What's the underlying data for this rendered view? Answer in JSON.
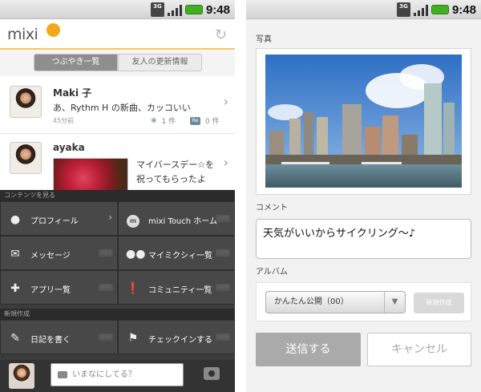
{
  "status_bar": {
    "time": "9:48",
    "network": "3G"
  },
  "left": {
    "app": {
      "logo": "mixi"
    },
    "tabs": [
      {
        "label": "つぶやき一覧",
        "active": true
      },
      {
        "label": "友人の更新情報",
        "active": false
      }
    ],
    "feed": [
      {
        "name": "Maki 子",
        "text": "あ、Rythm H の新曲、カッコいい",
        "time": "45分前",
        "likes": "1 件",
        "comments": "0 件"
      },
      {
        "name": "ayaka",
        "text_line1": "マイバースデー☆を",
        "text_line2": "祝ってもらったよ"
      }
    ],
    "menu": {
      "section_contents": "コンテンツを見る",
      "section_new": "新規作成",
      "web_tag": "WEB",
      "items": [
        {
          "label": "プロフィール",
          "icon": "person-icon"
        },
        {
          "label": "mixi Touch ホーム",
          "icon": "mixi-touch-icon"
        },
        {
          "label": "メッセージ",
          "icon": "envelope-icon"
        },
        {
          "label": "マイミクシィ一覧",
          "icon": "friends-icon"
        },
        {
          "label": "アプリ一覧",
          "icon": "puzzle-icon"
        },
        {
          "label": "コミュニティ一覧",
          "icon": "community-icon"
        },
        {
          "label": "日記を書く",
          "icon": "diary-icon"
        },
        {
          "label": "チェックインする",
          "icon": "checkin-flag-icon"
        }
      ],
      "mixi_touch_badge": "m"
    },
    "compose": {
      "placeholder": "いまなにしてる？"
    }
  },
  "right": {
    "photo_label": "写真",
    "comment_label": "コメント",
    "comment_value": "天気がいいからサイクリング～♪",
    "album_label": "アルバム",
    "album_selected": "かんたん公開（00）",
    "new_album_button": "新規作成",
    "send_button": "送信する",
    "cancel_button": "キャンセル"
  },
  "colors": {
    "accent_orange": "#f3a81c",
    "battery_green": "#41b020",
    "overlay_dark": "#3c3c3c"
  }
}
